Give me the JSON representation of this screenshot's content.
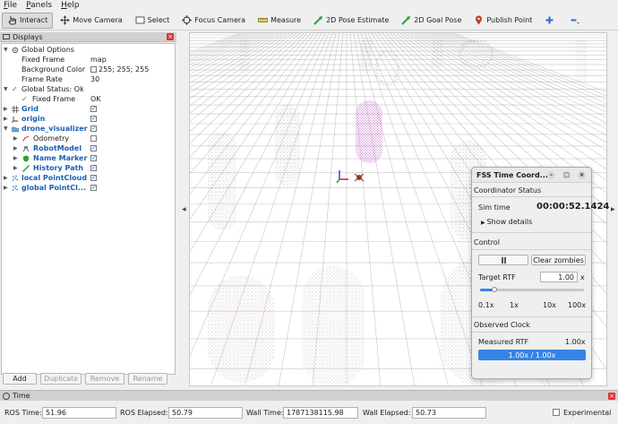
{
  "menu": {
    "file": "File",
    "panels": "Panels",
    "help": "Help"
  },
  "toolbar": {
    "interact": "Interact",
    "move_camera": "Move Camera",
    "select": "Select",
    "focus_camera": "Focus Camera",
    "measure": "Measure",
    "pose_estimate": "2D Pose Estimate",
    "goal_pose": "2D Goal Pose",
    "publish_point": "Publish Point"
  },
  "displays": {
    "title": "Displays",
    "global_options": "Global Options",
    "fixed_frame_label": "Fixed Frame",
    "fixed_frame_value": "map",
    "bg_color_label": "Background Color",
    "bg_color_value": "255; 255; 255",
    "frame_rate_label": "Frame Rate",
    "frame_rate_value": "30",
    "global_status": "Global Status: Ok",
    "fixed_frame_status_label": "Fixed Frame",
    "fixed_frame_status_value": "OK",
    "grid": "Grid",
    "origin": "origin",
    "drone_visualizer": "drone_visualizer",
    "odometry": "Odometry",
    "robot_model": "RobotModel",
    "name_marker": "Name Marker",
    "history_path": "History Path",
    "local_pointcloud": "local PointCloud",
    "global_pointcloud": "global PointCl...",
    "buttons": {
      "add": "Add",
      "duplicate": "Duplicate",
      "remove": "Remove",
      "rename": "Rename"
    }
  },
  "fss": {
    "title": "FSS Time Coord...",
    "coordinator_status": "Coordinator Status",
    "sim_time_label": "Sim time",
    "sim_time_value": "00:00:52.1424",
    "show_details": "Show details",
    "control": "Control",
    "pause_icon": "pause-icon",
    "clear_zombies": "Clear zombies",
    "target_rtf_label": "Target RTF",
    "target_rtf_value": "1.00",
    "target_rtf_unit": "x",
    "slider_fraction": 0.14,
    "ticks": [
      "0.1x",
      "1x",
      "10x",
      "100x"
    ],
    "observed_clock": "Observed Clock",
    "measured_rtf_label": "Measured RTF",
    "measured_rtf_value": "1.00x",
    "clock_bar": "1.00x / 1.00x"
  },
  "time": {
    "title": "Time",
    "ros_time_label": "ROS Time:",
    "ros_time_value": "51.96",
    "ros_elapsed_label": "ROS Elapsed:",
    "ros_elapsed_value": "50.79",
    "wall_time_label": "Wall Time:",
    "wall_time_value": "1787138115.98",
    "wall_elapsed_label": "Wall Elapsed:",
    "wall_elapsed_value": "50.73",
    "experimental": "Experimental"
  },
  "colors": {
    "accent": "#3584e4",
    "tree_blue": "#1a5fb4",
    "pointcloud": "#c86cd0"
  }
}
